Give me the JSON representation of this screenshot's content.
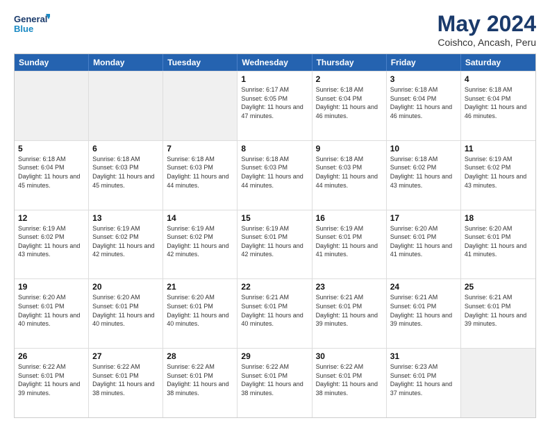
{
  "header": {
    "logo_line1": "General",
    "logo_line2": "Blue",
    "title": "May 2024",
    "subtitle": "Coishco, Ancash, Peru"
  },
  "weekdays": [
    "Sunday",
    "Monday",
    "Tuesday",
    "Wednesday",
    "Thursday",
    "Friday",
    "Saturday"
  ],
  "rows": [
    [
      {
        "day": "",
        "info": ""
      },
      {
        "day": "",
        "info": ""
      },
      {
        "day": "",
        "info": ""
      },
      {
        "day": "1",
        "info": "Sunrise: 6:17 AM\nSunset: 6:05 PM\nDaylight: 11 hours and 47 minutes."
      },
      {
        "day": "2",
        "info": "Sunrise: 6:18 AM\nSunset: 6:04 PM\nDaylight: 11 hours and 46 minutes."
      },
      {
        "day": "3",
        "info": "Sunrise: 6:18 AM\nSunset: 6:04 PM\nDaylight: 11 hours and 46 minutes."
      },
      {
        "day": "4",
        "info": "Sunrise: 6:18 AM\nSunset: 6:04 PM\nDaylight: 11 hours and 46 minutes."
      }
    ],
    [
      {
        "day": "5",
        "info": "Sunrise: 6:18 AM\nSunset: 6:04 PM\nDaylight: 11 hours and 45 minutes."
      },
      {
        "day": "6",
        "info": "Sunrise: 6:18 AM\nSunset: 6:03 PM\nDaylight: 11 hours and 45 minutes."
      },
      {
        "day": "7",
        "info": "Sunrise: 6:18 AM\nSunset: 6:03 PM\nDaylight: 11 hours and 44 minutes."
      },
      {
        "day": "8",
        "info": "Sunrise: 6:18 AM\nSunset: 6:03 PM\nDaylight: 11 hours and 44 minutes."
      },
      {
        "day": "9",
        "info": "Sunrise: 6:18 AM\nSunset: 6:03 PM\nDaylight: 11 hours and 44 minutes."
      },
      {
        "day": "10",
        "info": "Sunrise: 6:18 AM\nSunset: 6:02 PM\nDaylight: 11 hours and 43 minutes."
      },
      {
        "day": "11",
        "info": "Sunrise: 6:19 AM\nSunset: 6:02 PM\nDaylight: 11 hours and 43 minutes."
      }
    ],
    [
      {
        "day": "12",
        "info": "Sunrise: 6:19 AM\nSunset: 6:02 PM\nDaylight: 11 hours and 43 minutes."
      },
      {
        "day": "13",
        "info": "Sunrise: 6:19 AM\nSunset: 6:02 PM\nDaylight: 11 hours and 42 minutes."
      },
      {
        "day": "14",
        "info": "Sunrise: 6:19 AM\nSunset: 6:02 PM\nDaylight: 11 hours and 42 minutes."
      },
      {
        "day": "15",
        "info": "Sunrise: 6:19 AM\nSunset: 6:01 PM\nDaylight: 11 hours and 42 minutes."
      },
      {
        "day": "16",
        "info": "Sunrise: 6:19 AM\nSunset: 6:01 PM\nDaylight: 11 hours and 41 minutes."
      },
      {
        "day": "17",
        "info": "Sunrise: 6:20 AM\nSunset: 6:01 PM\nDaylight: 11 hours and 41 minutes."
      },
      {
        "day": "18",
        "info": "Sunrise: 6:20 AM\nSunset: 6:01 PM\nDaylight: 11 hours and 41 minutes."
      }
    ],
    [
      {
        "day": "19",
        "info": "Sunrise: 6:20 AM\nSunset: 6:01 PM\nDaylight: 11 hours and 40 minutes."
      },
      {
        "day": "20",
        "info": "Sunrise: 6:20 AM\nSunset: 6:01 PM\nDaylight: 11 hours and 40 minutes."
      },
      {
        "day": "21",
        "info": "Sunrise: 6:20 AM\nSunset: 6:01 PM\nDaylight: 11 hours and 40 minutes."
      },
      {
        "day": "22",
        "info": "Sunrise: 6:21 AM\nSunset: 6:01 PM\nDaylight: 11 hours and 40 minutes."
      },
      {
        "day": "23",
        "info": "Sunrise: 6:21 AM\nSunset: 6:01 PM\nDaylight: 11 hours and 39 minutes."
      },
      {
        "day": "24",
        "info": "Sunrise: 6:21 AM\nSunset: 6:01 PM\nDaylight: 11 hours and 39 minutes."
      },
      {
        "day": "25",
        "info": "Sunrise: 6:21 AM\nSunset: 6:01 PM\nDaylight: 11 hours and 39 minutes."
      }
    ],
    [
      {
        "day": "26",
        "info": "Sunrise: 6:22 AM\nSunset: 6:01 PM\nDaylight: 11 hours and 39 minutes."
      },
      {
        "day": "27",
        "info": "Sunrise: 6:22 AM\nSunset: 6:01 PM\nDaylight: 11 hours and 38 minutes."
      },
      {
        "day": "28",
        "info": "Sunrise: 6:22 AM\nSunset: 6:01 PM\nDaylight: 11 hours and 38 minutes."
      },
      {
        "day": "29",
        "info": "Sunrise: 6:22 AM\nSunset: 6:01 PM\nDaylight: 11 hours and 38 minutes."
      },
      {
        "day": "30",
        "info": "Sunrise: 6:22 AM\nSunset: 6:01 PM\nDaylight: 11 hours and 38 minutes."
      },
      {
        "day": "31",
        "info": "Sunrise: 6:23 AM\nSunset: 6:01 PM\nDaylight: 11 hours and 37 minutes."
      },
      {
        "day": "",
        "info": ""
      }
    ]
  ],
  "colors": {
    "header_bg": "#2563b0",
    "shaded_bg": "#f0f0f0"
  }
}
